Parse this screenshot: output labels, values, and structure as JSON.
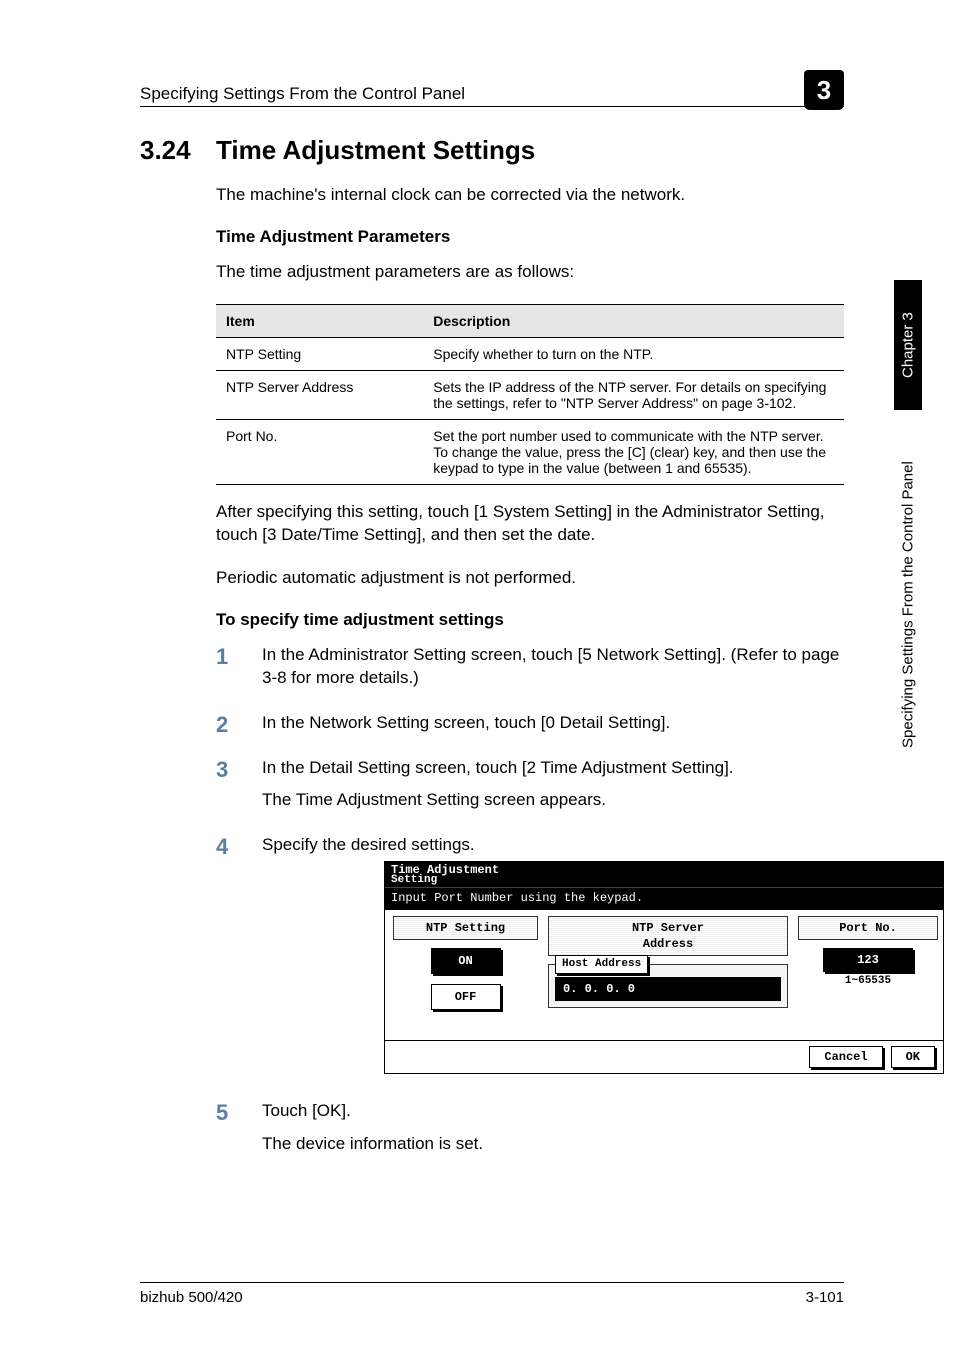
{
  "running_head": {
    "title": "Specifying Settings From the Control Panel",
    "chapter_badge": "3"
  },
  "section": {
    "number": "3.24",
    "title": "Time Adjustment Settings",
    "intro": "The machine's internal clock can be corrected via the network."
  },
  "params": {
    "heading": "Time Adjustment Parameters",
    "lead": "The time adjustment parameters are as follows:",
    "table": {
      "head_item": "Item",
      "head_desc": "Description",
      "rows": [
        {
          "item": "NTP Setting",
          "desc": "Specify whether to turn on the NTP."
        },
        {
          "item": "NTP Server Address",
          "desc": "Sets the IP address of the NTP server. For details on specifying the settings, refer to \"NTP Server Address\" on page 3-102."
        },
        {
          "item": "Port No.",
          "desc": "Set the port number used to communicate with the NTP server. To change the value, press the [C] (clear) key, and then use the keypad to type in the value (between 1 and 65535)."
        }
      ]
    },
    "after1": "After specifying this setting, touch [1 System Setting] in the Administrator Setting, touch [3 Date/Time Setting], and then set the date.",
    "after2": "Periodic automatic adjustment is not performed."
  },
  "procedure": {
    "heading": "To specify time adjustment settings",
    "steps": {
      "s1": "In the Administrator Setting screen, touch [5 Network Setting]. (Refer to page 3-8 for more details.)",
      "s2": "In the Network Setting screen, touch [0 Detail Setting].",
      "s3": "In the Detail Setting screen, touch [2 Time Adjustment Setting].",
      "s3b": "The Time Adjustment Setting screen appears.",
      "s4": "Specify the desired settings.",
      "s5": "Touch [OK].",
      "s5b": "The device information is set."
    }
  },
  "screen": {
    "title_line1": "Time Adjustment",
    "title_line2": "Setting",
    "subtitle": "Input Port Number using the keypad.",
    "col_left_label": "NTP Setting",
    "btn_on": "ON",
    "btn_off": "OFF",
    "col_mid_label": "NTP Server\nAddress",
    "host_label": "Host Address",
    "host_value": "0. 0. 0. 0",
    "col_right_label": "Port No.",
    "port_value": "123",
    "port_range": "1~65535",
    "cancel": "Cancel",
    "ok": "OK"
  },
  "sidebar": {
    "chapter": "Chapter 3",
    "long": "Specifying Settings From the Control Panel"
  },
  "footer": {
    "left": "bizhub 500/420",
    "right": "3-101"
  }
}
